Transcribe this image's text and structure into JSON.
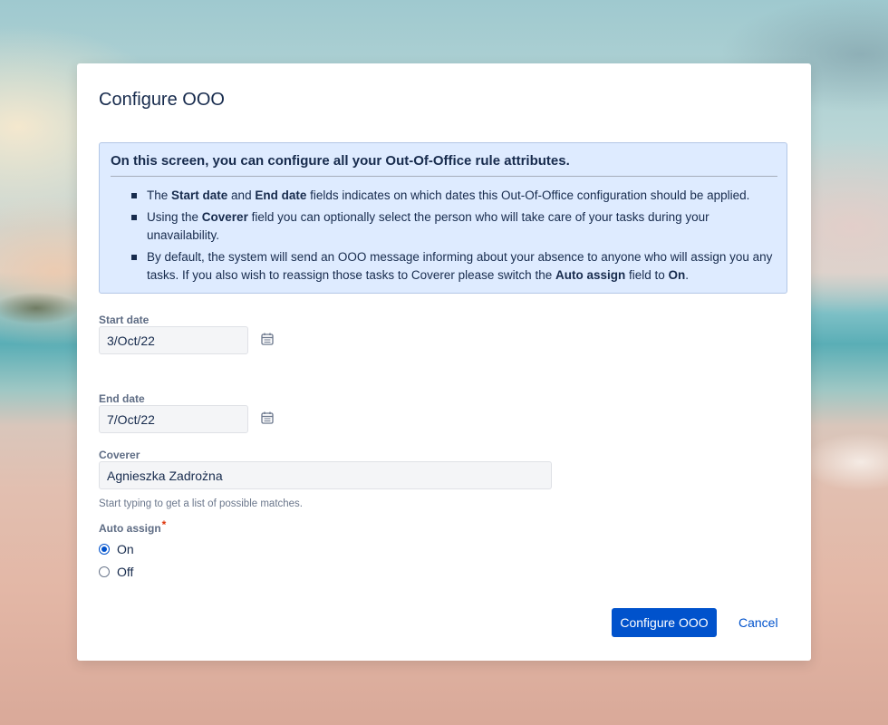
{
  "dialog": {
    "title": "Configure OOO"
  },
  "info": {
    "heading": "On this screen, you can configure all your Out-Of-Office rule attributes.",
    "bullets": [
      {
        "p1": "The ",
        "b1": "Start date",
        "p2": " and ",
        "b2": "End date",
        "p3": " fields indicates on which dates this Out-Of-Office configuration should be applied."
      },
      {
        "p1": "Using the ",
        "b1": "Coverer",
        "p2": " field you can optionally select the person who will take care of your tasks during your unavailability."
      },
      {
        "p1": "By default, the system will send an OOO message informing about your absence to anyone who will assign you any tasks. If you also wish to reassign those tasks to Coverer please switch the ",
        "b1": "Auto assign",
        "p2": " field to ",
        "b2": "On",
        "p3": "."
      }
    ]
  },
  "form": {
    "start_date": {
      "label": "Start date",
      "value": "3/Oct/22",
      "icon": "calendar-icon"
    },
    "end_date": {
      "label": "End date",
      "value": "7/Oct/22",
      "icon": "calendar-icon"
    },
    "coverer": {
      "label": "Coverer",
      "value": "Agnieszka Zadrożna",
      "help": "Start typing to get a list of possible matches."
    },
    "auto_assign": {
      "label": "Auto assign",
      "required_mark": "*",
      "options": [
        {
          "label": "On",
          "selected": true
        },
        {
          "label": "Off",
          "selected": false
        }
      ]
    }
  },
  "actions": {
    "submit_label": "Configure OOO",
    "cancel_label": "Cancel"
  },
  "colors": {
    "primary": "#0052cc",
    "info_background": "#deebff",
    "text": "#172b4d",
    "required": "#de350b"
  }
}
